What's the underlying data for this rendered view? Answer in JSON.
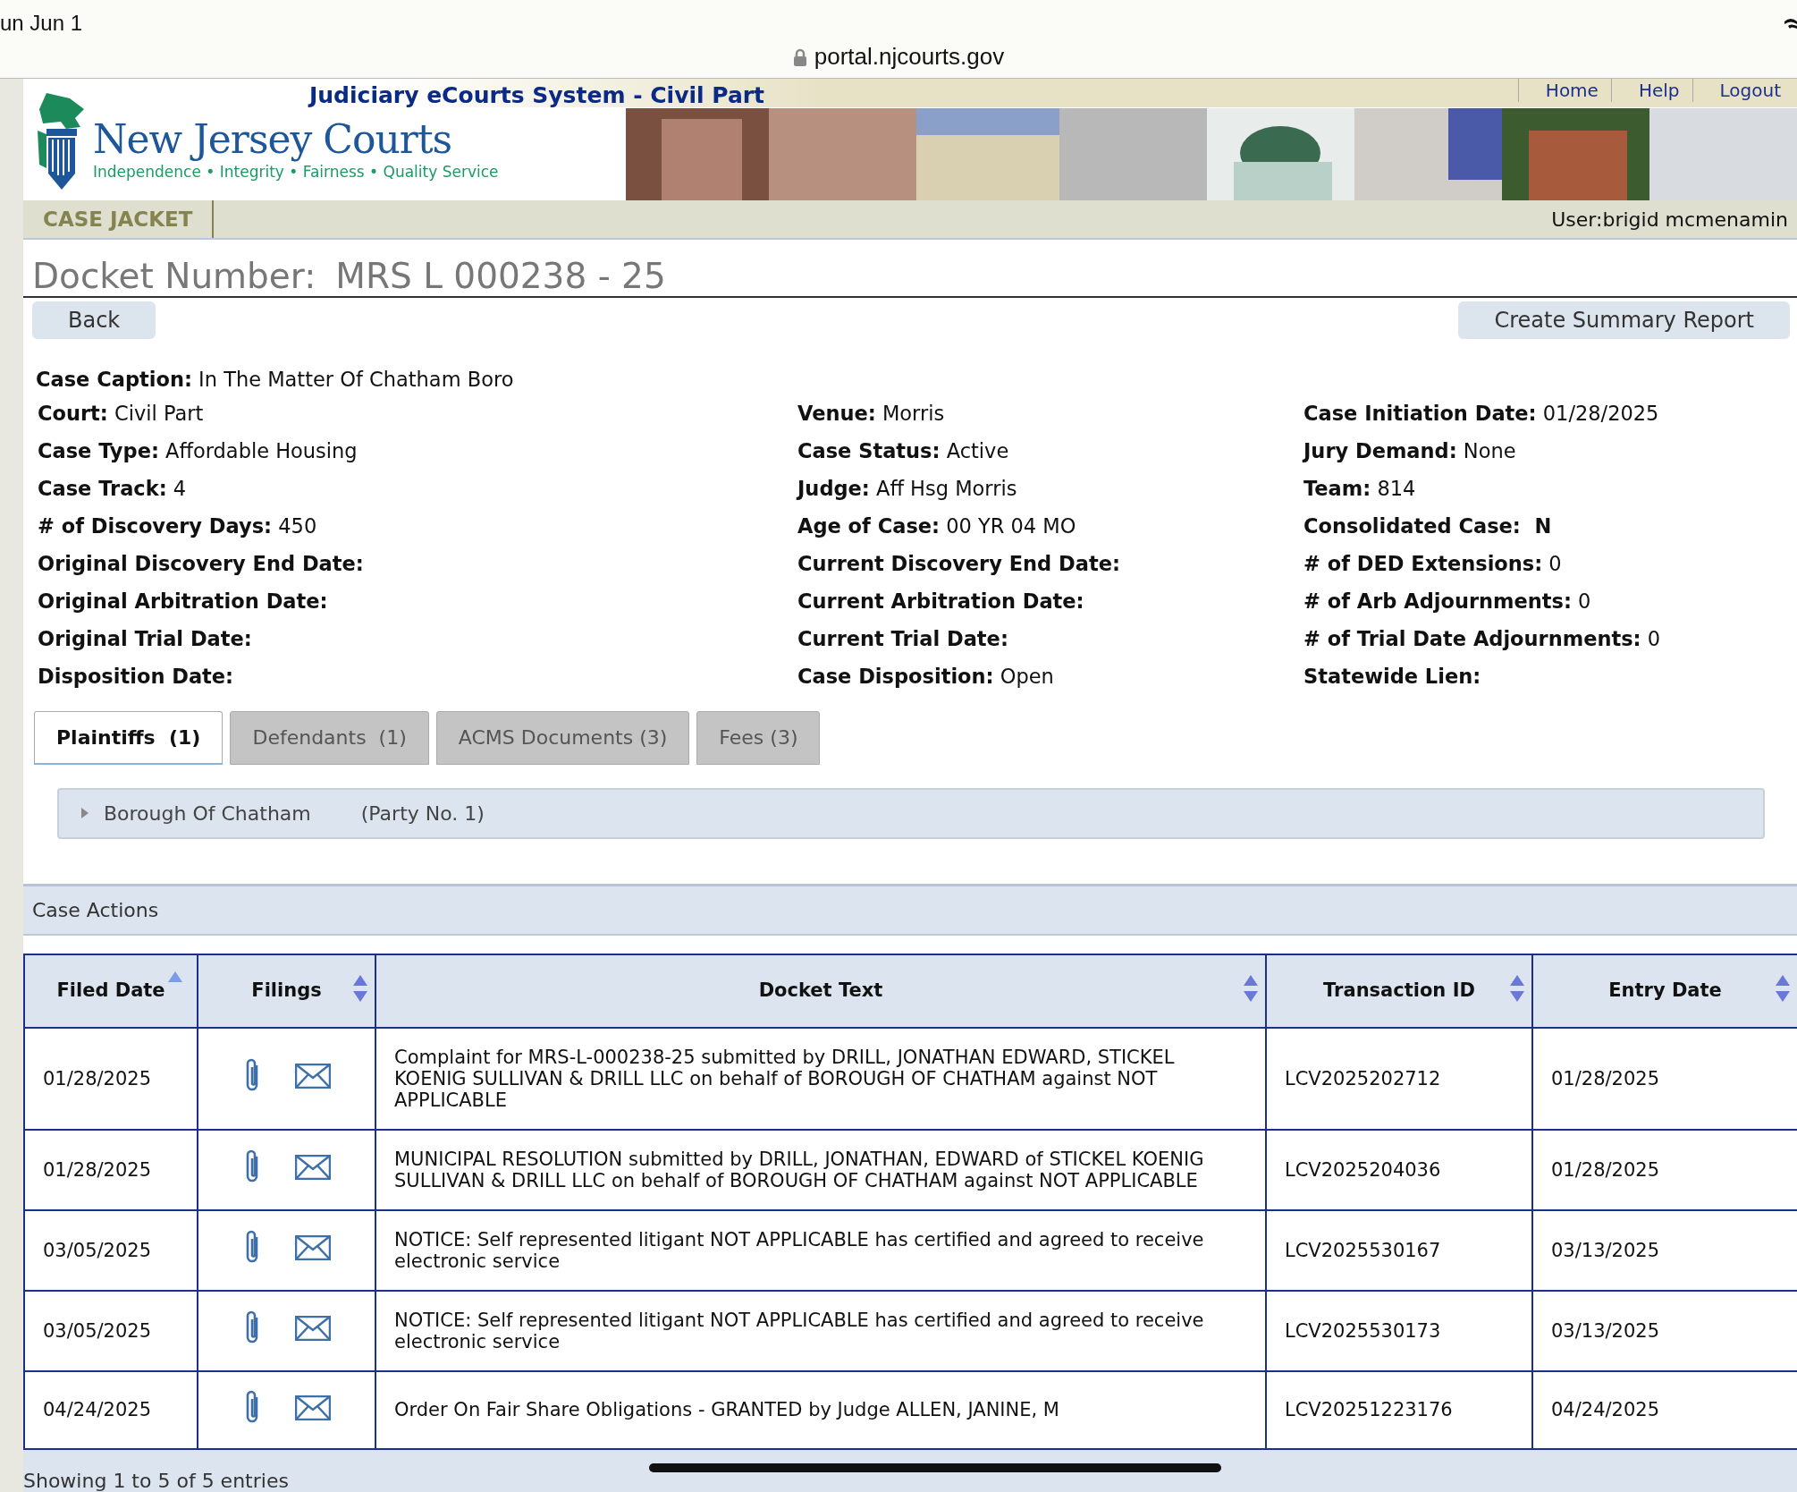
{
  "status_bar": {
    "time": "un Jun 1",
    "url": "portal.njcourts.gov"
  },
  "header": {
    "system_title": "Judiciary eCourts System - Civil Part",
    "logo_title": "New Jersey Courts",
    "logo_tagline": "Independence • Integrity • Fairness • Quality Service",
    "links": [
      "Home",
      "Help",
      "Logout"
    ],
    "section": "CASE JACKET",
    "user": "User:brigid mcmenamin"
  },
  "docket": {
    "label": "Docket Number:",
    "value": "MRS L 000238 - 25"
  },
  "buttons": {
    "back": "Back",
    "report": "Create Summary Report"
  },
  "case_caption": {
    "label": "Case Caption:",
    "value": "In The Matter Of Chatham Boro"
  },
  "field_columns": [
    [
      {
        "label": "Court:",
        "value": "Civil Part",
        "bold": false
      },
      {
        "label": "Case Type:",
        "value": "Affordable Housing",
        "bold": false
      },
      {
        "label": "Case Track:",
        "value": "4",
        "bold": false
      },
      {
        "label": "# of Discovery Days:",
        "value": "450",
        "bold": false
      },
      {
        "label": "Original Discovery End Date:"
      },
      {
        "label": "Original Arbitration Date:"
      },
      {
        "label": "Original Trial Date:"
      },
      {
        "label": "Disposition Date:"
      }
    ],
    [
      {
        "label": "Venue:",
        "value": "Morris",
        "bold": false
      },
      {
        "label": "Case Status:",
        "value": "Active",
        "bold": false
      },
      {
        "label": "Judge:",
        "value": "Aff Hsg Morris",
        "bold": false
      },
      {
        "label": "Age of Case:",
        "value": "00 YR 04 MO",
        "bold": false
      },
      {
        "label": "Current Discovery End Date:"
      },
      {
        "label": "Current Arbitration Date:"
      },
      {
        "label": "Current Trial Date:"
      },
      {
        "label": "Case Disposition:",
        "value": "Open",
        "bold": false
      }
    ],
    [
      {
        "label": "Case Initiation Date:",
        "value": "01/28/2025",
        "bold": false
      },
      {
        "label": "Jury Demand:",
        "value": "None",
        "bold": false
      },
      {
        "label": "Team:",
        "value": "814",
        "bold": false
      },
      {
        "label": "Consolidated Case:",
        "value": "N",
        "bold": true
      },
      {
        "label": "# of DED Extensions:",
        "value": "0",
        "bold": false
      },
      {
        "label": "# of Arb Adjournments:",
        "value": "0",
        "bold": false
      },
      {
        "label": "# of Trial Date Adjournments:",
        "value": "0",
        "bold": false
      },
      {
        "label": "Statewide Lien:"
      }
    ]
  ],
  "tabs": [
    {
      "label": "Plaintiffs  (1)",
      "selected": true
    },
    {
      "label": "Defendants  (1)",
      "selected": false
    },
    {
      "label": "ACMS Documents (3)",
      "selected": false
    },
    {
      "label": "Fees (3)",
      "selected": false
    }
  ],
  "parties": [
    {
      "name": "Borough Of Chatham",
      "number": "(Party No. 1)",
      "expanded": false
    }
  ],
  "case_actions": {
    "title": "Case Actions",
    "columns": [
      {
        "label": "Filed Date",
        "sorted": true
      },
      {
        "label": "Filings",
        "sorted": false
      },
      {
        "label": "Docket Text",
        "sorted": false
      },
      {
        "label": "Transaction ID",
        "sorted": false
      },
      {
        "label": "Entry Date",
        "sorted": false
      }
    ],
    "rows": [
      {
        "filed_date": "01/28/2025",
        "docket_text": "Complaint for MRS-L-000238-25 submitted by DRILL, JONATHAN EDWARD, STICKEL KOENIG SULLIVAN & DRILL LLC on behalf of BOROUGH OF CHATHAM against NOT APPLICABLE",
        "transaction_id": "LCV2025202712",
        "entry_date": "01/28/2025"
      },
      {
        "filed_date": "01/28/2025",
        "docket_text": "MUNICIPAL RESOLUTION submitted by DRILL, JONATHAN, EDWARD of STICKEL KOENIG SULLIVAN & DRILL LLC on behalf of BOROUGH OF CHATHAM against NOT APPLICABLE",
        "transaction_id": "LCV2025204036",
        "entry_date": "01/28/2025"
      },
      {
        "filed_date": "03/05/2025",
        "docket_text": "NOTICE: Self represented litigant NOT APPLICABLE has certified and agreed to receive electronic service",
        "transaction_id": "LCV2025530167",
        "entry_date": "03/13/2025"
      },
      {
        "filed_date": "03/05/2025",
        "docket_text": "NOTICE: Self represented litigant NOT APPLICABLE has certified and agreed to receive electronic service",
        "transaction_id": "LCV2025530173",
        "entry_date": "03/13/2025"
      },
      {
        "filed_date": "04/24/2025",
        "docket_text": "Order On Fair Share Obligations - GRANTED by Judge ALLEN, JANINE, M",
        "transaction_id": "LCV20251223176",
        "entry_date": "04/24/2025"
      }
    ],
    "footer": "Showing 1 to 5 of 5 entries"
  }
}
